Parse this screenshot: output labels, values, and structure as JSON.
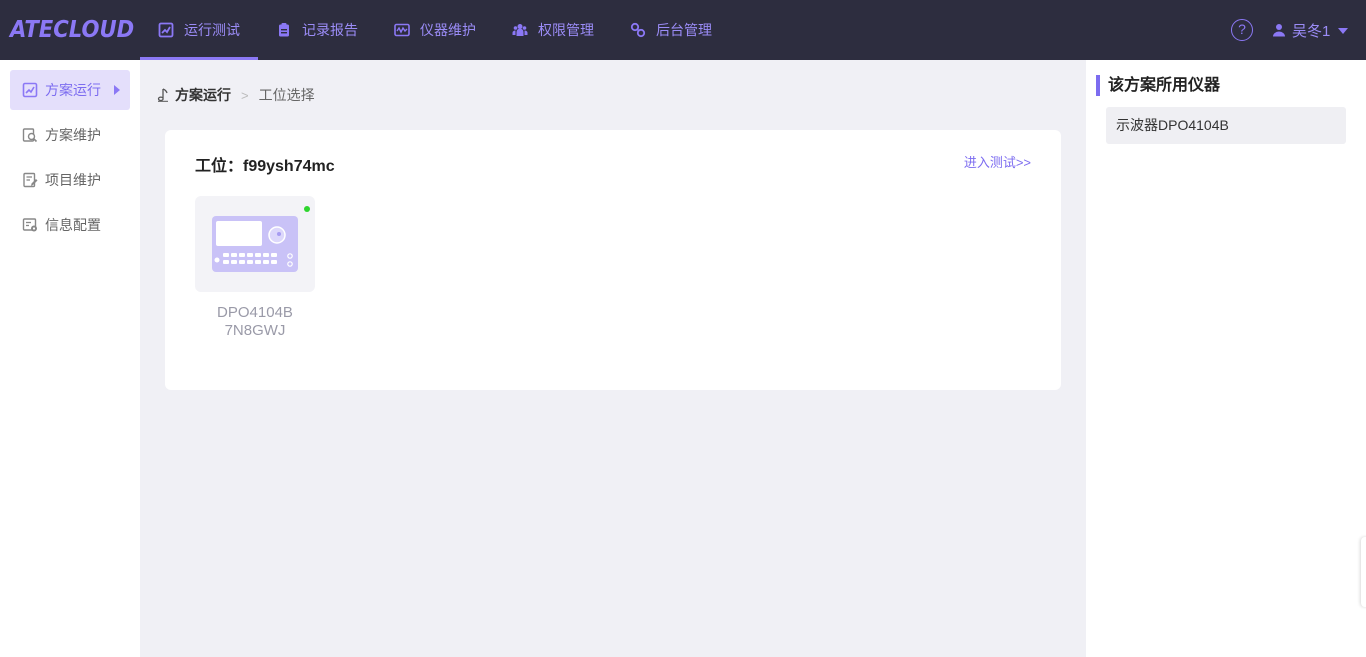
{
  "app": {
    "logo": "ATECLOUD"
  },
  "nav": {
    "items": [
      {
        "label": "运行测试",
        "icon": "chart-icon",
        "active": true
      },
      {
        "label": "记录报告",
        "icon": "clipboard-icon",
        "active": false
      },
      {
        "label": "仪器维护",
        "icon": "instrument-icon",
        "active": false
      },
      {
        "label": "权限管理",
        "icon": "users-icon",
        "active": false
      },
      {
        "label": "后台管理",
        "icon": "settings-icon",
        "active": false
      }
    ],
    "help": "?",
    "user": "吴冬1"
  },
  "sidebar": {
    "items": [
      {
        "label": "方案运行",
        "icon": "chart-icon",
        "active": true
      },
      {
        "label": "方案维护",
        "icon": "search-doc-icon",
        "active": false
      },
      {
        "label": "项目维护",
        "icon": "doc-edit-icon",
        "active": false
      },
      {
        "label": "信息配置",
        "icon": "config-icon",
        "active": false
      }
    ]
  },
  "breadcrumb": {
    "items": [
      "方案运行",
      "工位选择"
    ]
  },
  "station": {
    "title": "工位：f99ysh74mc",
    "enter": "进入测试>>",
    "device": {
      "model": "DPO4104B",
      "serial": "7N8GWJ",
      "status_color": "#2ed52e"
    }
  },
  "right_panel": {
    "title": "该方案所用仪器",
    "items": [
      "示波器DPO4104B"
    ]
  },
  "colors": {
    "accent": "#8b78f5",
    "topbar": "#2d2d3f",
    "background": "#f0f0f5"
  }
}
